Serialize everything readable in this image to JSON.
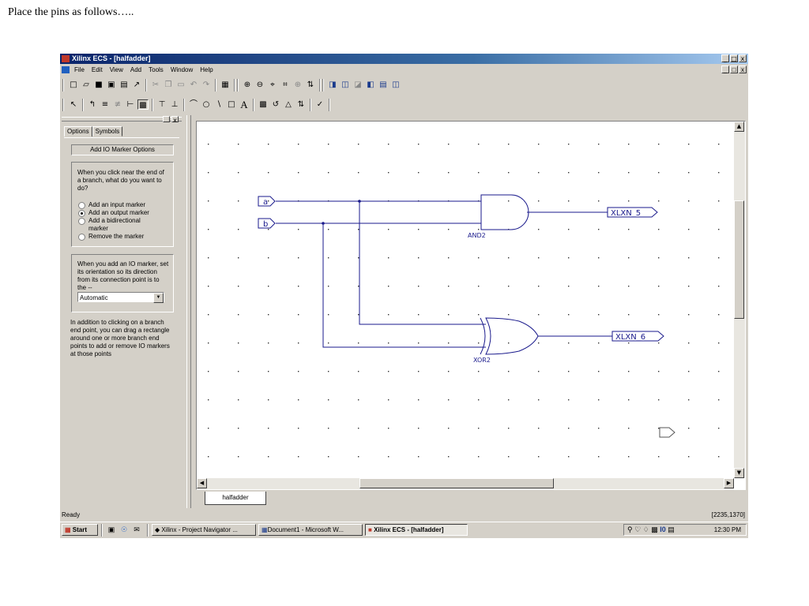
{
  "caption": "Place the pins as follows…..",
  "window": {
    "title": "Xilinx ECS - [halfadder]",
    "controls": [
      "_",
      "□",
      "x"
    ]
  },
  "menu": [
    "File",
    "Edit",
    "View",
    "Add",
    "Tools",
    "Window",
    "Help"
  ],
  "panel": {
    "tabs": [
      "Options",
      "Symbols"
    ],
    "header": "Add IO Marker Options",
    "question": "When you click near the end of a branch, what do you want to do?",
    "options": [
      {
        "label": "Add an input marker",
        "selected": false
      },
      {
        "label": "Add an output marker",
        "selected": true
      },
      {
        "label": "Add a bidirectional marker",
        "selected": false
      },
      {
        "label": "Remove the marker",
        "selected": false
      }
    ],
    "orientation_text": "When you add an IO marker, set its orientation so its direction from its connection point is to the --",
    "orientation_value": "Automatic",
    "help_text": "In addition to clicking on a branch end point, you can drag a rectangle around one or more branch end points to add or remove IO markers at those points"
  },
  "schematic": {
    "inputs": [
      "a",
      "b"
    ],
    "gates": [
      "AND2",
      "XOR2"
    ],
    "outputs": [
      "XLXN_5",
      "XLXN_6"
    ]
  },
  "doc_tab": "halfadder",
  "status": {
    "text": "Ready",
    "coords": "[2235,1370]"
  },
  "taskbar": {
    "start": "Start",
    "tasks": [
      "Xilinx - Project Navigator ...",
      "Document1 - Microsoft W...",
      "Xilinx ECS - [halfadder]"
    ],
    "clock": "12:30 PM"
  },
  "colors": {
    "wire": "#1a1a8c",
    "titlebar": "#0a246a",
    "chrome": "#d4d0c8"
  }
}
